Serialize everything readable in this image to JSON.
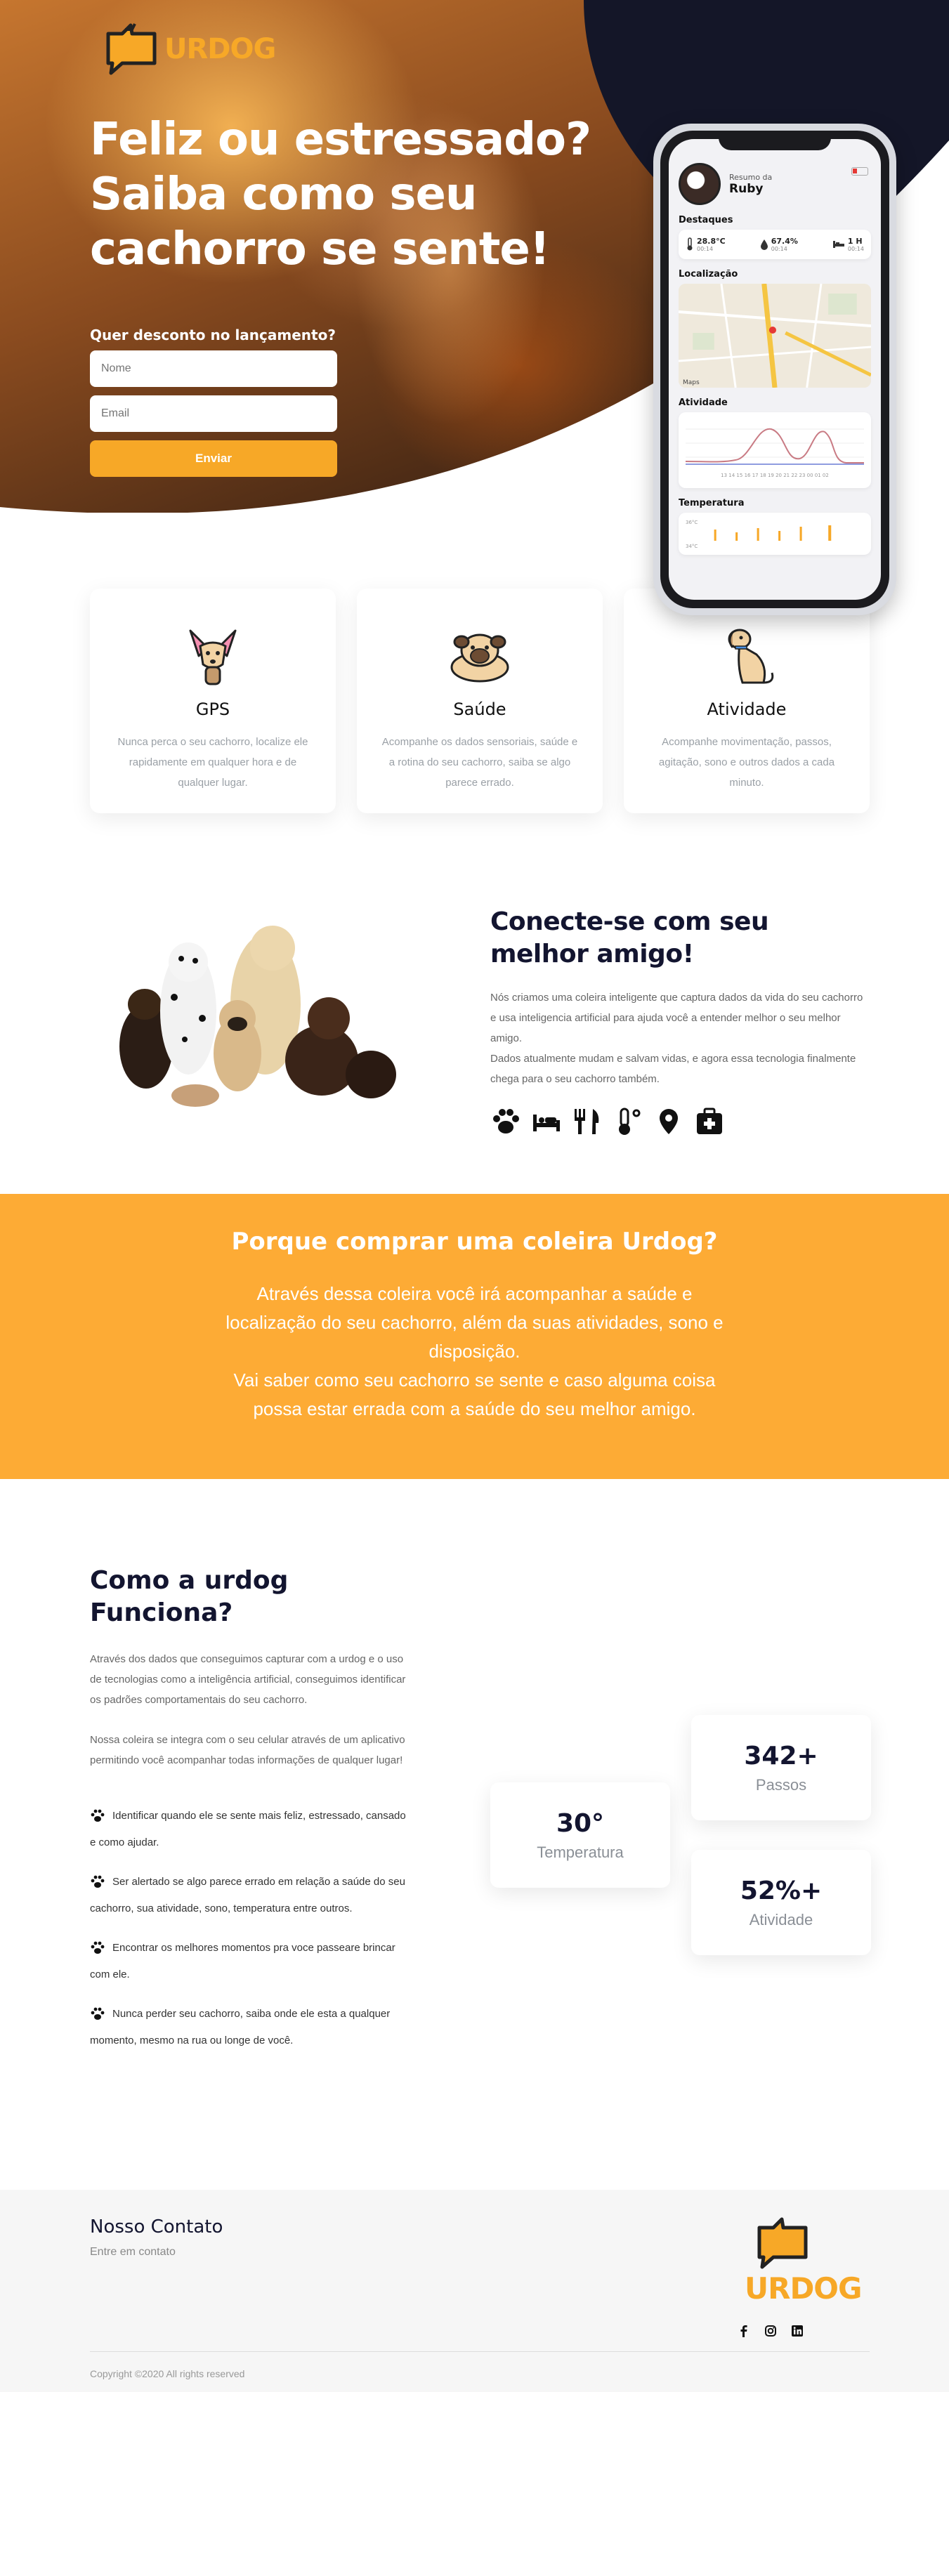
{
  "brand": {
    "logo_text": "URDOG",
    "accent_color": "#f7a827",
    "dark_color": "#131530"
  },
  "hero": {
    "title_line1": "Feliz ou estressado?",
    "title_line2": "Saiba como seu",
    "title_line3": "cachorro se sente!",
    "form_label": "Quer desconto no lançamento?",
    "name_placeholder": "Nome",
    "email_placeholder": "Email",
    "submit_label": "Enviar"
  },
  "phone": {
    "summary_label": "Resumo da",
    "dog_name": "Ruby",
    "highlights_title": "Destaques",
    "stats": [
      {
        "icon": "thermometer-icon",
        "value": "28.8°C",
        "time": "00:14"
      },
      {
        "icon": "droplet-icon",
        "value": "67.4%",
        "time": "00:14"
      },
      {
        "icon": "bed-icon",
        "value": "1 H",
        "time": "00:14"
      }
    ],
    "location_title": "Localização",
    "map_attribution": "Maps",
    "activity_title": "Atividade",
    "activity_axis": "13 14 15 16 17 18 19 20 21 22 23 00 01 02",
    "temperature_title": "Temperatura",
    "temp_ticks": [
      "36°C",
      "34°C"
    ]
  },
  "features": [
    {
      "icon": "chihuahua-icon",
      "title": "GPS",
      "desc": "Nunca perca o seu cachorro, localize ele rapidamente em qualquer hora e de qualquer lugar."
    },
    {
      "icon": "pug-icon",
      "title": "Saúde",
      "desc": "Acompanhe os dados sensoriais, saúde e a rotina do seu cachorro, saiba se algo parece errado."
    },
    {
      "icon": "sitting-dog-icon",
      "title": "Atividade",
      "desc": "Acompanhe movimentação, passos, agitação, sono e outros dados a cada minuto."
    }
  ],
  "connect": {
    "title": "Conecte-se com seu melhor amigo!",
    "body1": "Nós criamos uma coleira inteligente que captura dados da vida do seu cachorro e usa inteligencia artificial para ajuda você a entender melhor o seu melhor amigo.",
    "body2": "Dados atualmente mudam e salvam vidas, e agora essa tecnologia finalmente chega para o seu cachorro também.",
    "icons": [
      "paw-icon",
      "bed-icon",
      "utensils-icon",
      "thermometer-icon",
      "map-pin-icon",
      "first-aid-icon"
    ]
  },
  "banner": {
    "title": "Porque comprar uma coleira Urdog?",
    "body1": "Através dessa coleira você irá acompanhar a saúde e localização do seu cachorro, além da suas atividades, sono e disposição.",
    "body2": "Vai saber como seu cachorro se sente e caso alguma coisa possa estar errada com a saúde do seu melhor amigo."
  },
  "how": {
    "title": "Como a urdog Funciona?",
    "p1": "Através dos dados que conseguimos capturar com a urdog e o uso de tecnologias como a inteligência artificial, conseguimos identificar os padrões comportamentais do seu cachorro.",
    "p2": "Nossa coleira se integra com o seu celular através de um aplicativo permitindo você acompanhar todas informações de qualquer lugar!",
    "items": [
      "Identificar quando ele se sente mais feliz, estressado, cansado e como ajudar.",
      "Ser alertado se algo parece errado em relação a saúde do seu cachorro, sua atividade, sono, temperatura entre outros.",
      "Encontrar os melhores momentos pra voce passeare brincar com ele.",
      "Nunca perder seu cachorro, saiba onde ele esta a qualquer momento, mesmo na rua ou longe de você."
    ],
    "stats": [
      {
        "value": "342+",
        "label": "Passos"
      },
      {
        "value": "30°",
        "label": "Temperatura"
      },
      {
        "value": "52%+",
        "label": "Atividade"
      }
    ]
  },
  "footer": {
    "title": "Nosso Contato",
    "subtitle": "Entre em contato",
    "logo_text": "URDOG",
    "social": [
      "facebook-icon",
      "instagram-icon",
      "linkedin-icon"
    ],
    "copyright": "Copyright ©2020 All rights reserved"
  }
}
